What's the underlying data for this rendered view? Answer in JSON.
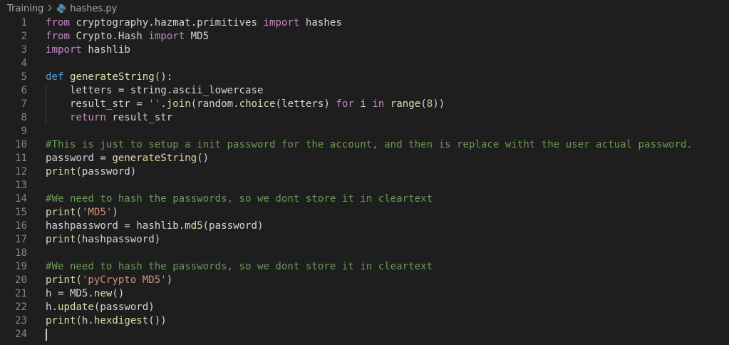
{
  "breadcrumb": {
    "folder": "Training",
    "file": "hashes.py"
  },
  "icons": {
    "separator": "chevron-right-icon",
    "file": "python-file-icon"
  },
  "colors": {
    "background": "#1e1e1e",
    "keyword": "#c586c0",
    "storage": "#569cd6",
    "function": "#dcdcaa",
    "string": "#ce9178",
    "number": "#b5cea8",
    "comment": "#6a9955",
    "line_number": "#858585"
  },
  "code": {
    "lines": [
      {
        "num": "1",
        "tokens": [
          {
            "t": "kw",
            "v": "from"
          },
          {
            "t": "p",
            "v": " cryptography.hazmat.primitives "
          },
          {
            "t": "kw",
            "v": "import"
          },
          {
            "t": "p",
            "v": " hashes"
          }
        ]
      },
      {
        "num": "2",
        "tokens": [
          {
            "t": "kw",
            "v": "from"
          },
          {
            "t": "p",
            "v": " Crypto.Hash "
          },
          {
            "t": "kw",
            "v": "import"
          },
          {
            "t": "p",
            "v": " MD5"
          }
        ]
      },
      {
        "num": "3",
        "tokens": [
          {
            "t": "kw",
            "v": "import"
          },
          {
            "t": "p",
            "v": " hashlib"
          }
        ]
      },
      {
        "num": "4",
        "tokens": []
      },
      {
        "num": "5",
        "tokens": [
          {
            "t": "def",
            "v": "def"
          },
          {
            "t": "p",
            "v": " "
          },
          {
            "t": "fn",
            "v": "generateString"
          },
          {
            "t": "p",
            "v": "():"
          }
        ]
      },
      {
        "num": "6",
        "tokens": [
          {
            "t": "p",
            "v": "    letters = string.ascii_lowercase"
          }
        ]
      },
      {
        "num": "7",
        "tokens": [
          {
            "t": "p",
            "v": "    result_str = "
          },
          {
            "t": "str",
            "v": "''"
          },
          {
            "t": "p",
            "v": "."
          },
          {
            "t": "fn",
            "v": "join"
          },
          {
            "t": "p",
            "v": "(random."
          },
          {
            "t": "fn",
            "v": "choice"
          },
          {
            "t": "p",
            "v": "(letters) "
          },
          {
            "t": "kw",
            "v": "for"
          },
          {
            "t": "p",
            "v": " i "
          },
          {
            "t": "kw",
            "v": "in"
          },
          {
            "t": "p",
            "v": " "
          },
          {
            "t": "fn",
            "v": "range"
          },
          {
            "t": "p",
            "v": "("
          },
          {
            "t": "num",
            "v": "8"
          },
          {
            "t": "p",
            "v": "))"
          }
        ]
      },
      {
        "num": "8",
        "tokens": [
          {
            "t": "p",
            "v": "    "
          },
          {
            "t": "kw",
            "v": "return"
          },
          {
            "t": "p",
            "v": " result_str"
          }
        ]
      },
      {
        "num": "9",
        "tokens": []
      },
      {
        "num": "10",
        "tokens": [
          {
            "t": "cm",
            "v": "#This is just to setup a init password for the account, and then is replace witht the user actual password."
          }
        ]
      },
      {
        "num": "11",
        "tokens": [
          {
            "t": "p",
            "v": "password = "
          },
          {
            "t": "fn",
            "v": "generateString"
          },
          {
            "t": "p",
            "v": "()"
          }
        ]
      },
      {
        "num": "12",
        "tokens": [
          {
            "t": "fn",
            "v": "print"
          },
          {
            "t": "p",
            "v": "(password)"
          }
        ]
      },
      {
        "num": "13",
        "tokens": []
      },
      {
        "num": "14",
        "tokens": [
          {
            "t": "cm",
            "v": "#We need to hash the passwords, so we dont store it in cleartext"
          }
        ]
      },
      {
        "num": "15",
        "tokens": [
          {
            "t": "fn",
            "v": "print"
          },
          {
            "t": "p",
            "v": "("
          },
          {
            "t": "str",
            "v": "'MD5'"
          },
          {
            "t": "p",
            "v": ")"
          }
        ]
      },
      {
        "num": "16",
        "tokens": [
          {
            "t": "p",
            "v": "hashpassword = hashlib."
          },
          {
            "t": "fn",
            "v": "md5"
          },
          {
            "t": "p",
            "v": "(password)"
          }
        ]
      },
      {
        "num": "17",
        "tokens": [
          {
            "t": "fn",
            "v": "print"
          },
          {
            "t": "p",
            "v": "(hashpassword)"
          }
        ]
      },
      {
        "num": "18",
        "tokens": []
      },
      {
        "num": "19",
        "tokens": [
          {
            "t": "cm",
            "v": "#We need to hash the passwords, so we dont store it in cleartext"
          }
        ]
      },
      {
        "num": "20",
        "tokens": [
          {
            "t": "fn",
            "v": "print"
          },
          {
            "t": "p",
            "v": "("
          },
          {
            "t": "str",
            "v": "'pyCrypto MD5'"
          },
          {
            "t": "p",
            "v": ")"
          }
        ]
      },
      {
        "num": "21",
        "tokens": [
          {
            "t": "p",
            "v": "h = MD5."
          },
          {
            "t": "fn",
            "v": "new"
          },
          {
            "t": "p",
            "v": "()"
          }
        ]
      },
      {
        "num": "22",
        "tokens": [
          {
            "t": "p",
            "v": "h."
          },
          {
            "t": "fn",
            "v": "update"
          },
          {
            "t": "p",
            "v": "(password)"
          }
        ]
      },
      {
        "num": "23",
        "tokens": [
          {
            "t": "fn",
            "v": "print"
          },
          {
            "t": "p",
            "v": "(h."
          },
          {
            "t": "fn",
            "v": "hexdigest"
          },
          {
            "t": "p",
            "v": "())"
          }
        ]
      },
      {
        "num": "24",
        "tokens": [],
        "cursor": true
      }
    ]
  }
}
